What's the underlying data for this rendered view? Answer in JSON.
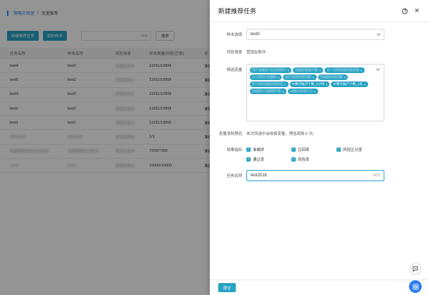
{
  "breadcrumb": [
    "策略实验室",
    "变量推荐"
  ],
  "toolbar": {
    "create_label": "新建推荐任务",
    "my_samples_label": "我的样本",
    "search_placeholder": "搜索",
    "query_label": "搜索"
  },
  "table": {
    "headers": [
      "任务名称",
      "样本名称",
      "风险场景",
      "样本数量(风险/正常)",
      "评"
    ],
    "rows": [
      [
        "test4",
        "test2",
        "营销反欺诈",
        "11911/10999",
        "准确"
      ],
      [
        "test5",
        "test2",
        "营销反欺诈",
        "11911/10999",
        "准确"
      ],
      [
        "test3",
        "test2",
        "营销反欺诈",
        "11911/10999",
        "准确"
      ],
      [
        "test2",
        "test2",
        "营销反欺诈",
        "11911/10999",
        "准确"
      ],
      [
        "test1",
        "test1",
        "营销反欺诈",
        "11911/10000",
        "准确"
      ],
      [
        "样本任务",
        "样本任务",
        "营销反欺诈",
        "1/1",
        "准确"
      ],
      [
        "变量推荐样本任务名称",
        "变量推荐样本欺诈",
        "营销反欺诈",
        "7259/7300",
        "准确"
      ],
      [
        "test0",
        "test0",
        "营销反欺诈",
        "10000/10000",
        "准确"
      ]
    ]
  },
  "drawer": {
    "title": "新建推荐任务",
    "sample_label": "样本选择",
    "sample_value": "test0",
    "scene_label": "风险场景",
    "scene_value": "营销反欺诈",
    "candidates_label": "候选变量",
    "tags": [
      {
        "text": "用户设备近7天交易评分",
        "blur": true
      },
      {
        "text": "设备关联账户数",
        "blur": true
      },
      {
        "text": "近一天同设备登录次数",
        "blur": true
      },
      {
        "text": "近7天同IP注册数",
        "blur": true
      },
      {
        "text": "账户登录失败次数",
        "blur": true
      },
      {
        "text": "同设备申请次数",
        "blur": true
      },
      {
        "text": "近7天同设备异常标记",
        "blur": true
      },
      {
        "text": "IP累计账户个数_1小时",
        "blur": false
      },
      {
        "text": "IP累计账户个数_1天",
        "blur": false
      },
      {
        "text": "设备累计注册账户数",
        "blur": true
      },
      {
        "text": "近期IP异常行为",
        "blur": true
      }
    ],
    "usage_label": "变量消耗预估",
    "usage_text": "本次所选中会收费变量，预估调用 6 次。",
    "metrics_label": "效果指标",
    "metrics": [
      "准确率",
      "召回率",
      "风险区分度",
      "通过率",
      "风险率"
    ],
    "name_label": "任务名称",
    "name_value": "test2018",
    "name_counter": "8/32",
    "submit_label": "提交"
  },
  "icons": {
    "help": "help-icon",
    "close": "close-icon",
    "chat": "chat-icon",
    "apps": "grid-icon"
  },
  "colors": {
    "accent": "#26a2c3",
    "link": "#2d8cf0"
  }
}
